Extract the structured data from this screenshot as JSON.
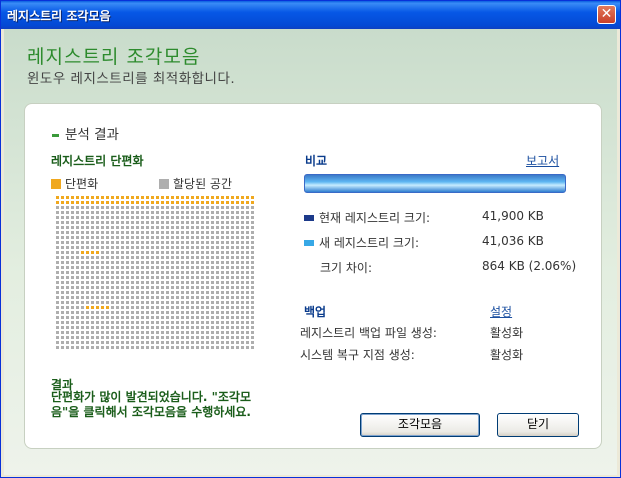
{
  "window": {
    "title": "레지스트리 조각모음"
  },
  "header": {
    "title": "레지스트리 조각모음",
    "subtitle": "윈도우 레지스트리를 최적화합니다."
  },
  "analysis": {
    "section_title": "분석 결과",
    "fragmentation": {
      "title": "레지스트리 단편화",
      "legend_fragmented": "단편화",
      "legend_allocated": "할당된 공간",
      "fragmented_color": "#f0a81e",
      "allocated_color": "#aeaeae"
    },
    "result": {
      "label": "결과",
      "text": "단편화가 많이 발견되었습니다. \"조각모음\"을 클릭해서 조각모음을 수행하세요."
    },
    "comparison": {
      "title": "비교",
      "report_link": "보고서",
      "current_label": "현재 레지스트리 크기:",
      "current_value": "41,900 KB",
      "new_label": "새 레지스트리 크기:",
      "new_value": "41,036 KB",
      "diff_label": "크기 차이:",
      "diff_value": "864 KB (2.06%)",
      "current_color": "#1c3a8a",
      "new_color": "#37a8e6"
    },
    "backup": {
      "title": "백업",
      "settings_link": "설정",
      "backup_label": "레지스트리 백업 파일 생성:",
      "backup_value": "활성화",
      "restore_label": "시스템 복구 지점 생성:",
      "restore_value": "활성화"
    }
  },
  "buttons": {
    "defrag": "조각모음",
    "close": "닫기"
  }
}
